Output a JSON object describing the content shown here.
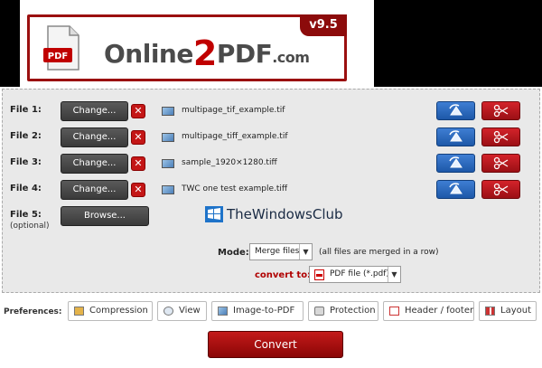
{
  "header": {
    "logo_text_pre": "Online",
    "logo_text_num": "2",
    "logo_text_post": "PDF",
    "logo_text_domain": ".com",
    "doc_label": "PDF",
    "version": "v9.5"
  },
  "files": [
    {
      "label": "File 1:",
      "button": "Change...",
      "name": "multipage_tif_example.tif"
    },
    {
      "label": "File 2:",
      "button": "Change...",
      "name": "multipage_tiff_example.tif"
    },
    {
      "label": "File 3:",
      "button": "Change...",
      "name": "sample_1920×1280.tiff"
    },
    {
      "label": "File 4:",
      "button": "Change...",
      "name": "TWC one test example.tiff"
    }
  ],
  "file5": {
    "label": "File 5:",
    "optional": "(optional)",
    "button": "Browse..."
  },
  "remove_symbol": "✕",
  "watermark": "TheWindowsClub",
  "mode": {
    "label": "Mode:",
    "value": "Merge files",
    "hint": "(all files are merged in a row)"
  },
  "convert_to": {
    "label": "convert to:",
    "value": "PDF file (*.pdf)"
  },
  "preferences": {
    "label": "Preferences:",
    "items": [
      "Compression",
      "View",
      "Image-to-PDF",
      "Protection",
      "Header / footer",
      "Layout"
    ]
  },
  "convert_button": "Convert",
  "colors": {
    "accent_red": "#9b1010",
    "rotate_blue": "#1d58a8",
    "panel_bg": "#e9e9e9"
  }
}
